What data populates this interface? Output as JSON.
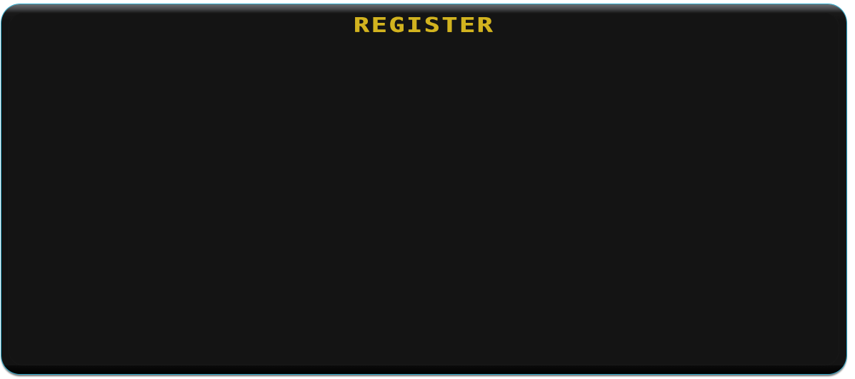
{
  "dialog": {
    "title": "REGISTER"
  },
  "colors": {
    "title": "#d2b31f",
    "panel_background": "#141414",
    "border_accent": "#2aa7c9"
  }
}
